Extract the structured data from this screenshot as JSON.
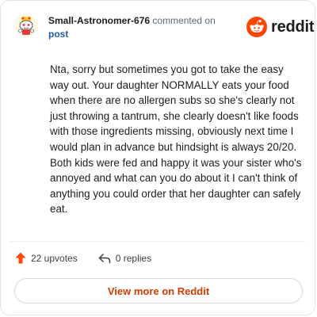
{
  "comment": {
    "author": "Small-Astronomer-676",
    "action_text": "commented on",
    "target_link": "post",
    "body": "Nta, sorry but sometimes you got to take the easy way out. Your daughter NORMALLY eats your food when there are no allergen subs so she's clearly not just throwing a tantrum, she clearly doesn't like foods with those ingredients missing, obviously next time I would plan in advance but hindsight is always 20/20. Both kids were fed and happy it was your sister who's annoyed and what can you do about it I can't think of anything you could order that her daughter can safely eat."
  },
  "brand": {
    "wordmark": "reddit",
    "icon": "reddit-snoo-icon",
    "color": "#ff4500"
  },
  "footer": {
    "upvotes": "22 upvotes",
    "upvote_icon": "upvote-arrow-icon",
    "upvote_color": "#ff4500",
    "replies": "0 replies",
    "reply_icon": "reply-icon"
  },
  "view_button": {
    "label": "View more on Reddit",
    "color": "#d93a00"
  }
}
